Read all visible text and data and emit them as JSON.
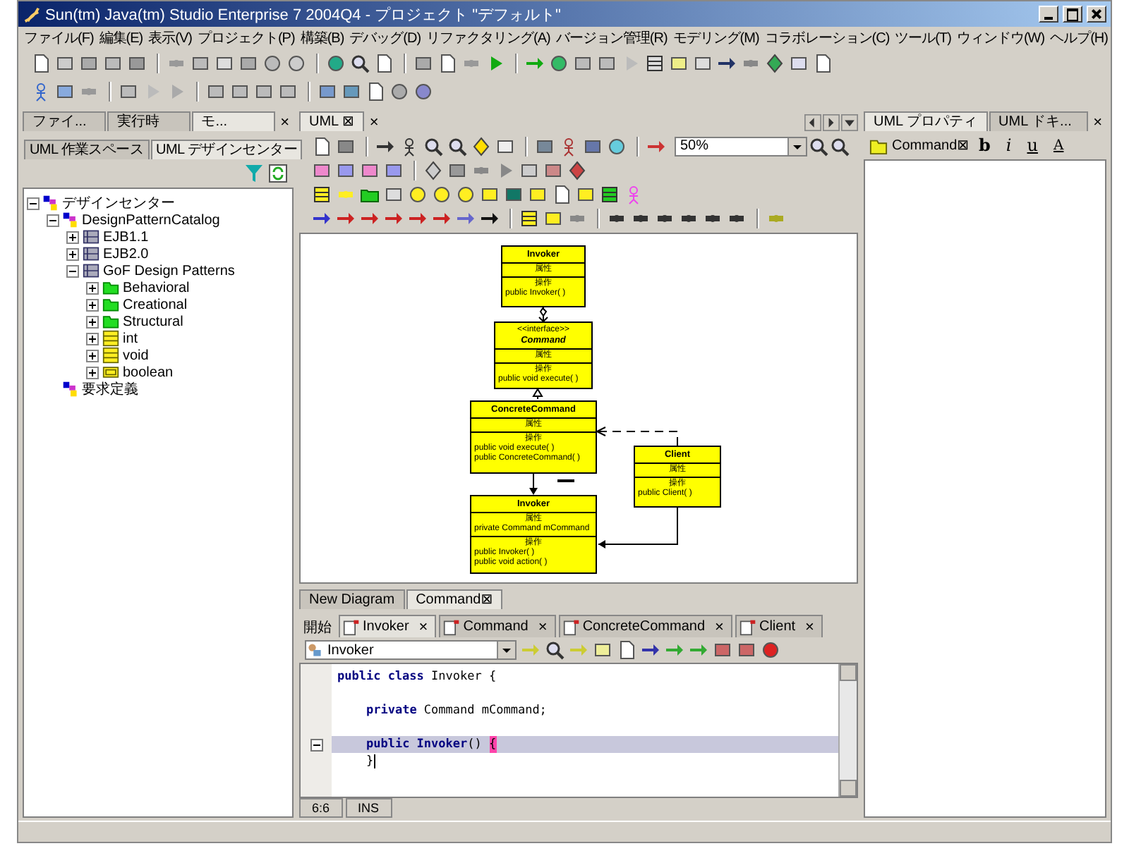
{
  "window": {
    "title": "Sun(tm) Java(tm) Studio Enterprise 7 2004Q4 - プロジェクト \"デフォルト\""
  },
  "menu": [
    "ファイル(F)",
    "編集(E)",
    "表示(V)",
    "プロジェクト(P)",
    "構築(B)",
    "デバッグ(D)",
    "リファクタリング(A)",
    "バージョン管理(R)",
    "モデリング(M)",
    "コラボレーション(C)",
    "ツール(T)",
    "ウィンドウ(W)",
    "ヘルプ(H)"
  ],
  "left_panel": {
    "tabs": [
      {
        "label": "ファイ...",
        "selected": false
      },
      {
        "label": "実行時",
        "selected": false
      },
      {
        "label": "モ...",
        "selected": true
      }
    ],
    "close": "×",
    "subtabs": [
      {
        "label": "UML 作業スペース",
        "selected": false
      },
      {
        "label": "UML デザインセンター",
        "selected": true
      }
    ],
    "tree": [
      {
        "label": "デザインセンター",
        "kind": "model",
        "expanded": true,
        "children": [
          {
            "label": "DesignPatternCatalog",
            "kind": "model",
            "expanded": true,
            "children": [
              {
                "label": "EJB1.1",
                "kind": "package",
                "expanded": false
              },
              {
                "label": "EJB2.0",
                "kind": "package",
                "expanded": false
              },
              {
                "label": "GoF Design Patterns",
                "kind": "package",
                "expanded": true,
                "children": [
                  {
                    "label": "Behavioral",
                    "kind": "folder",
                    "expanded": false
                  },
                  {
                    "label": "Creational",
                    "kind": "folder",
                    "expanded": false
                  },
                  {
                    "label": "Structural",
                    "kind": "folder",
                    "expanded": false
                  },
                  {
                    "label": "int",
                    "kind": "class",
                    "expanded": false
                  },
                  {
                    "label": "void",
                    "kind": "class",
                    "expanded": false
                  },
                  {
                    "label": "boolean",
                    "kind": "datatype",
                    "expanded": false
                  }
                ]
              }
            ]
          },
          {
            "label": "要求定義",
            "kind": "model"
          }
        ]
      }
    ]
  },
  "editor_area": {
    "tab": {
      "label": "UML ⊠",
      "close": "×"
    },
    "zoom": "50%",
    "diagram": {
      "classes": [
        {
          "name": "Invoker",
          "attributes_label": "属性",
          "operations_label": "操作",
          "operations": [
            "public Invoker( )"
          ]
        },
        {
          "name": "Command",
          "stereotype": "<<interface>>",
          "attributes_label": "属性",
          "operations_label": "操作",
          "operations": [
            "public void execute( )"
          ]
        },
        {
          "name": "ConcreteCommand",
          "attributes_label": "属性",
          "operations_label": "操作",
          "operations": [
            "public void execute( )",
            "public ConcreteCommand( )"
          ]
        },
        {
          "name": "Client",
          "attributes_label": "属性",
          "operations_label": "操作",
          "operations": [
            "public Client( )"
          ]
        },
        {
          "name": "Invoker",
          "attributes_label": "属性",
          "attributes": [
            "private Command mCommand"
          ],
          "operations_label": "操作",
          "operations": [
            "public Invoker( )",
            "public void action( )"
          ]
        }
      ]
    },
    "diagram_tabs": [
      {
        "label": "New Diagram",
        "selected": false
      },
      {
        "label": "Command⊠",
        "selected": true
      }
    ]
  },
  "source_editor": {
    "start_label": "開始",
    "tabs": [
      {
        "label": "Invoker",
        "close": "×",
        "selected": true
      },
      {
        "label": "Command",
        "close": "×",
        "selected": false
      },
      {
        "label": "ConcreteCommand",
        "close": "×",
        "selected": false
      },
      {
        "label": "Client",
        "close": "×",
        "selected": false
      }
    ],
    "member_combo": "Invoker",
    "lines": [
      {
        "kind": "code",
        "text": "**public class** Invoker {"
      },
      {
        "kind": "blank"
      },
      {
        "kind": "code",
        "text": "    **private** Command mCommand;"
      },
      {
        "kind": "blank"
      },
      {
        "kind": "code",
        "text": "    **public Invoker**() ",
        "brace": "{",
        "highlighted": true,
        "fold": true
      },
      {
        "kind": "code",
        "text": "    }",
        "caret": true
      }
    ],
    "status": [
      "6:6",
      "INS"
    ]
  },
  "right_panel": {
    "tabs": [
      {
        "label": "UML プロパティ",
        "selected": true
      },
      {
        "label": "UML ドキ...",
        "selected": false
      }
    ],
    "close": "×",
    "element": "Command⊠",
    "format_buttons": [
      "b",
      "i",
      "u",
      "A"
    ]
  }
}
